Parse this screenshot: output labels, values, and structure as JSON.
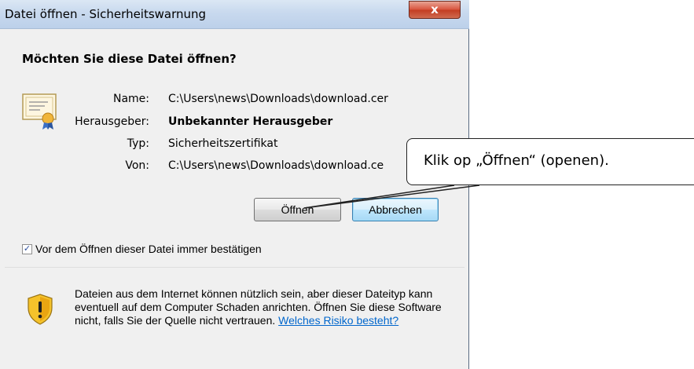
{
  "window": {
    "title": "Datei öffnen - Sicherheitswarnung",
    "close_glyph": "x"
  },
  "heading": "Möchten Sie diese Datei öffnen?",
  "fields": [
    {
      "label": "Name:",
      "value": "C:\\Users\\news\\Downloads\\download.cer"
    },
    {
      "label": "Herausgeber:",
      "value": "Unbekannter Herausgeber"
    },
    {
      "label": "Typ:",
      "value": "Sicherheitszertifikat"
    },
    {
      "label": "Von:",
      "value": "C:\\Users\\news\\Downloads\\download.ce"
    }
  ],
  "buttons": {
    "open": "Öffnen",
    "cancel": "Abbrechen"
  },
  "checkbox": {
    "label": "Vor dem Öffnen dieser Datei immer bestätigen",
    "checked": true,
    "mark": "✓"
  },
  "warning": {
    "text": "Dateien aus dem Internet können nützlich sein, aber dieser Dateityp kann eventuell auf dem Computer Schaden anrichten. Öffnen Sie diese Software nicht, falls Sie der Quelle nicht vertrauen. ",
    "link": "Welches Risiko besteht?"
  },
  "callout": {
    "text": "Klik op „Öffnen“ (openen)."
  },
  "icons": {
    "certificate": "certificate-icon",
    "shield": "security-shield-icon"
  },
  "colors": {
    "link": "#0066cc",
    "close": "#c33d22",
    "titlebar": "#c8d9ee"
  }
}
